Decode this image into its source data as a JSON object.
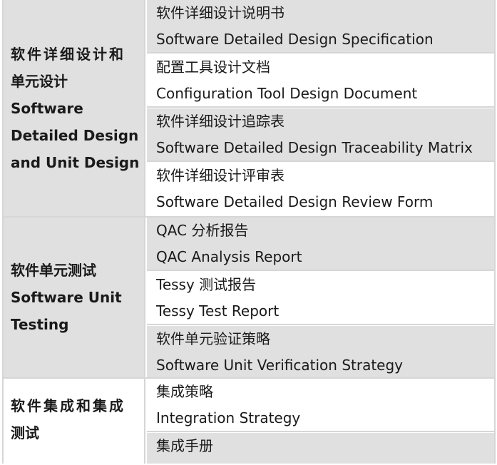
{
  "groups": [
    {
      "phase_lines": [
        "软件详细设计和",
        "单元设计",
        "Software",
        "Detailed Design",
        "and Unit Design"
      ],
      "rows": [
        {
          "zh": "软件详细设计说明书",
          "en": "Software Detailed Design Specification"
        },
        {
          "zh": "配置工具设计文档",
          "en": "Configuration Tool Design Document"
        },
        {
          "zh": "软件详细设计追踪表",
          "en": "Software Detailed Design Traceability Matrix"
        },
        {
          "zh": "软件详细设计评审表",
          "en": "Software Detailed Design Review Form"
        }
      ]
    },
    {
      "phase_lines": [
        "软件单元测试",
        "Software Unit",
        "Testing"
      ],
      "rows": [
        {
          "zh": "QAC 分析报告",
          "en": "QAC Analysis Report"
        },
        {
          "zh": "Tessy 测试报告",
          "en": "Tessy Test Report"
        },
        {
          "zh": "软件单元验证策略",
          "en": "Software Unit Verification Strategy"
        }
      ]
    },
    {
      "phase_lines": [
        "软件集成和集成",
        "测试"
      ],
      "rows": [
        {
          "zh": "集成策略",
          "en": "Integration Strategy"
        },
        {
          "zh": "集成手册",
          "en": ""
        }
      ]
    }
  ]
}
